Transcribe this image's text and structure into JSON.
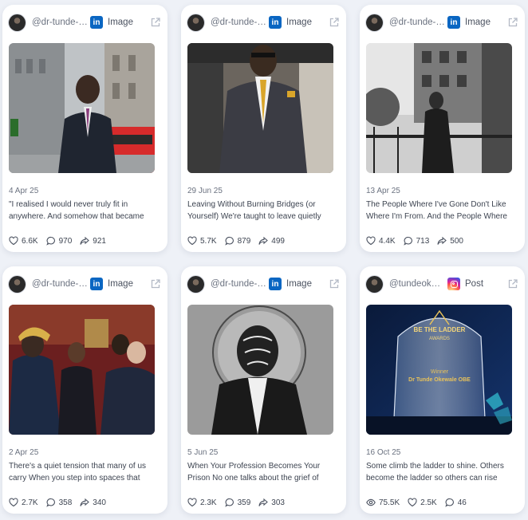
{
  "cards": [
    {
      "handle": "@dr-tunde-okewale-obe",
      "source": "Image",
      "platform": "linkedin",
      "date": "4 Apr 25",
      "text": "\"I realised I would never truly fit in anywhere. And somehow that became",
      "stats": [
        {
          "icon": "heart-icon",
          "value": "6.6K"
        },
        {
          "icon": "comment-icon",
          "value": "970"
        },
        {
          "icon": "share-icon",
          "value": "921"
        }
      ]
    },
    {
      "handle": "@dr-tunde-okewale-obe",
      "source": "Image",
      "platform": "linkedin",
      "date": "29 Jun 25",
      "text": "Leaving Without Burning Bridges (or Yourself) We're taught to leave quietly",
      "stats": [
        {
          "icon": "heart-icon",
          "value": "5.7K"
        },
        {
          "icon": "comment-icon",
          "value": "879"
        },
        {
          "icon": "share-icon",
          "value": "499"
        }
      ]
    },
    {
      "handle": "@dr-tunde-okewale-obe",
      "source": "Image",
      "platform": "linkedin",
      "date": "13 Apr 25",
      "text": "The People Where I've Gone Don't Like Where I'm From. And the People Where",
      "stats": [
        {
          "icon": "heart-icon",
          "value": "4.4K"
        },
        {
          "icon": "comment-icon",
          "value": "713"
        },
        {
          "icon": "share-icon",
          "value": "500"
        }
      ]
    },
    {
      "handle": "@dr-tunde-okewale-obe",
      "source": "Image",
      "platform": "linkedin",
      "date": "2 Apr 25",
      "text": "There's a quiet tension that many of us carry When you step into spaces that",
      "stats": [
        {
          "icon": "heart-icon",
          "value": "2.7K"
        },
        {
          "icon": "comment-icon",
          "value": "358"
        },
        {
          "icon": "share-icon",
          "value": "340"
        }
      ]
    },
    {
      "handle": "@dr-tunde-okewale-obe",
      "source": "Image",
      "platform": "linkedin",
      "date": "5 Jun 25",
      "text": "When Your Profession Becomes Your Prison No one talks about the grief of",
      "stats": [
        {
          "icon": "heart-icon",
          "value": "2.3K"
        },
        {
          "icon": "comment-icon",
          "value": "359"
        },
        {
          "icon": "share-icon",
          "value": "303"
        }
      ]
    },
    {
      "handle": "@tundeokewale",
      "source": "Post",
      "platform": "instagram",
      "date": "16 Oct 25",
      "text": "Some climb the ladder to shine. Others become the ladder so others can rise",
      "stats": [
        {
          "icon": "eye-icon",
          "value": "75.5K"
        },
        {
          "icon": "heart-icon",
          "value": "2.5K"
        },
        {
          "icon": "comment-icon",
          "value": "46"
        }
      ]
    }
  ],
  "award": {
    "line1": "BE THE LADDER",
    "line2": "AWARDS",
    "winner": "Winner",
    "name": "Dr Tunde Okewale OBE"
  },
  "colors": {
    "linkedin": "#0a66c2",
    "background": "#eef1f7",
    "card": "#ffffff"
  }
}
